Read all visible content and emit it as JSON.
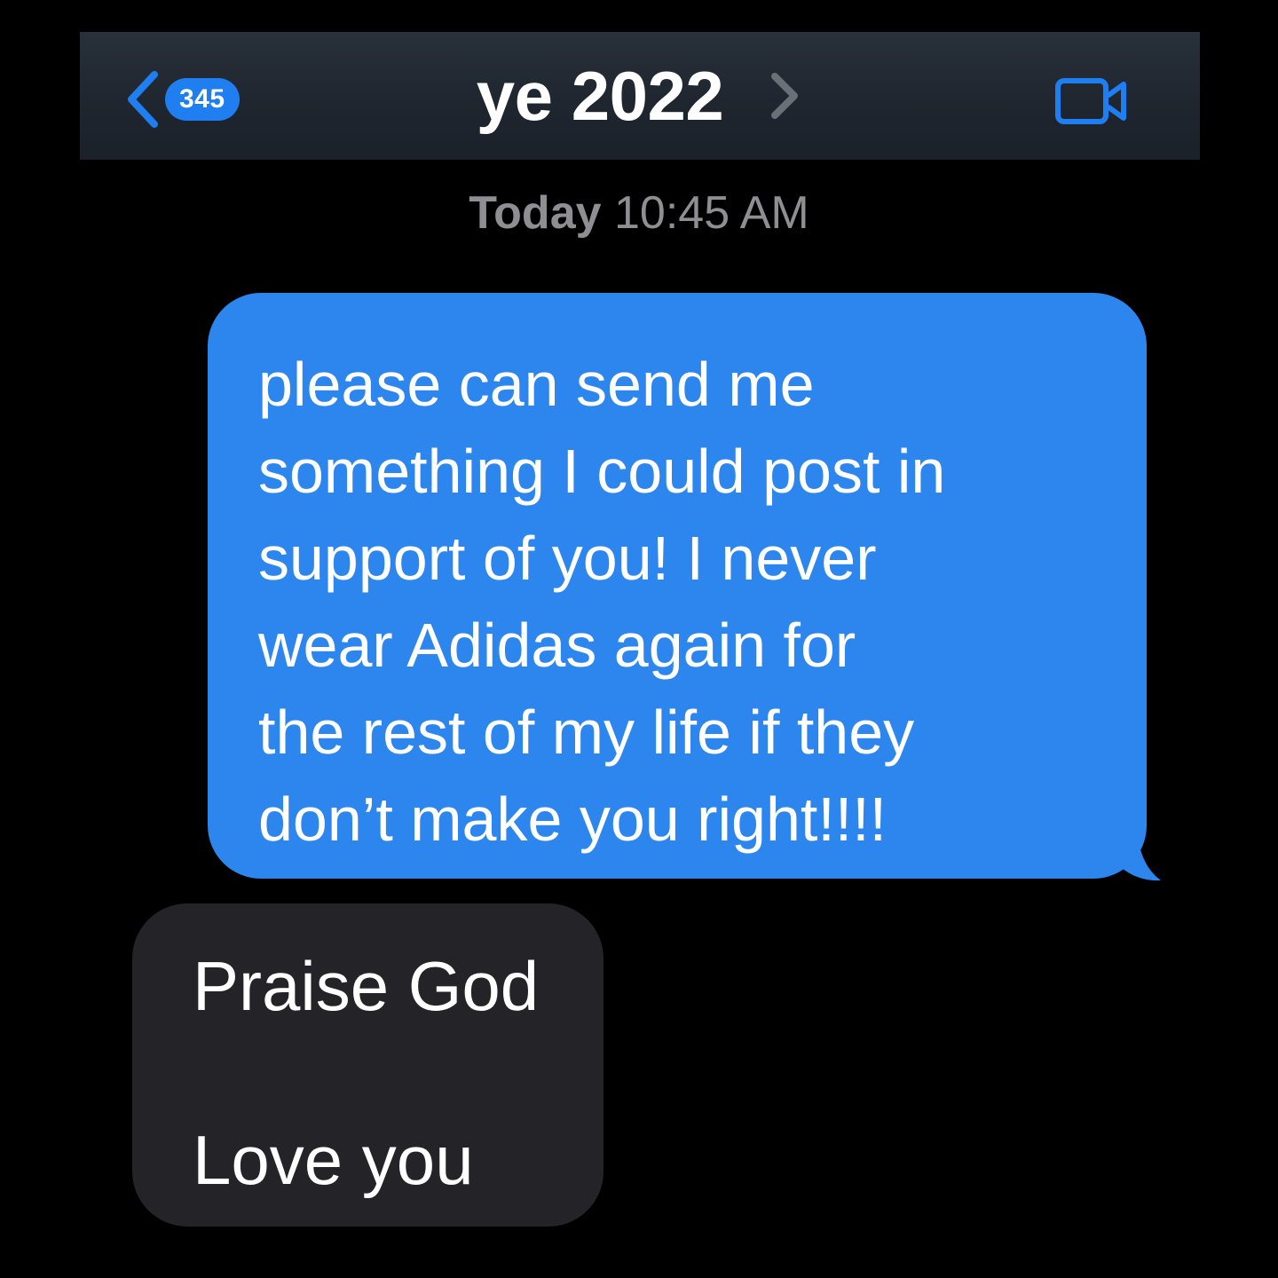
{
  "colors": {
    "background": "#000000",
    "navbar": "#222a33",
    "accent": "#1f7ef0",
    "outgoing_bubble": "#2d86ee",
    "incoming_bubble": "#242428",
    "secondary_text": "#8e8e93"
  },
  "navbar": {
    "back_icon": "chevron-left-icon",
    "unread_count": "345",
    "contact_name": "ye 2022",
    "contact_chevron_icon": "chevron-right-icon",
    "video_icon": "video-camera-icon"
  },
  "thread": {
    "timestamp_day": "Today",
    "timestamp_time": "10:45 AM",
    "messages": [
      {
        "direction": "outgoing",
        "lines": [
          "please can send me",
          "something I could post in",
          "support of you! I never",
          "wear Adidas again for",
          "the rest of my life if they",
          "don’t make you right!!!!"
        ]
      },
      {
        "direction": "incoming",
        "lines": [
          "Praise God",
          "Love you"
        ]
      }
    ]
  }
}
